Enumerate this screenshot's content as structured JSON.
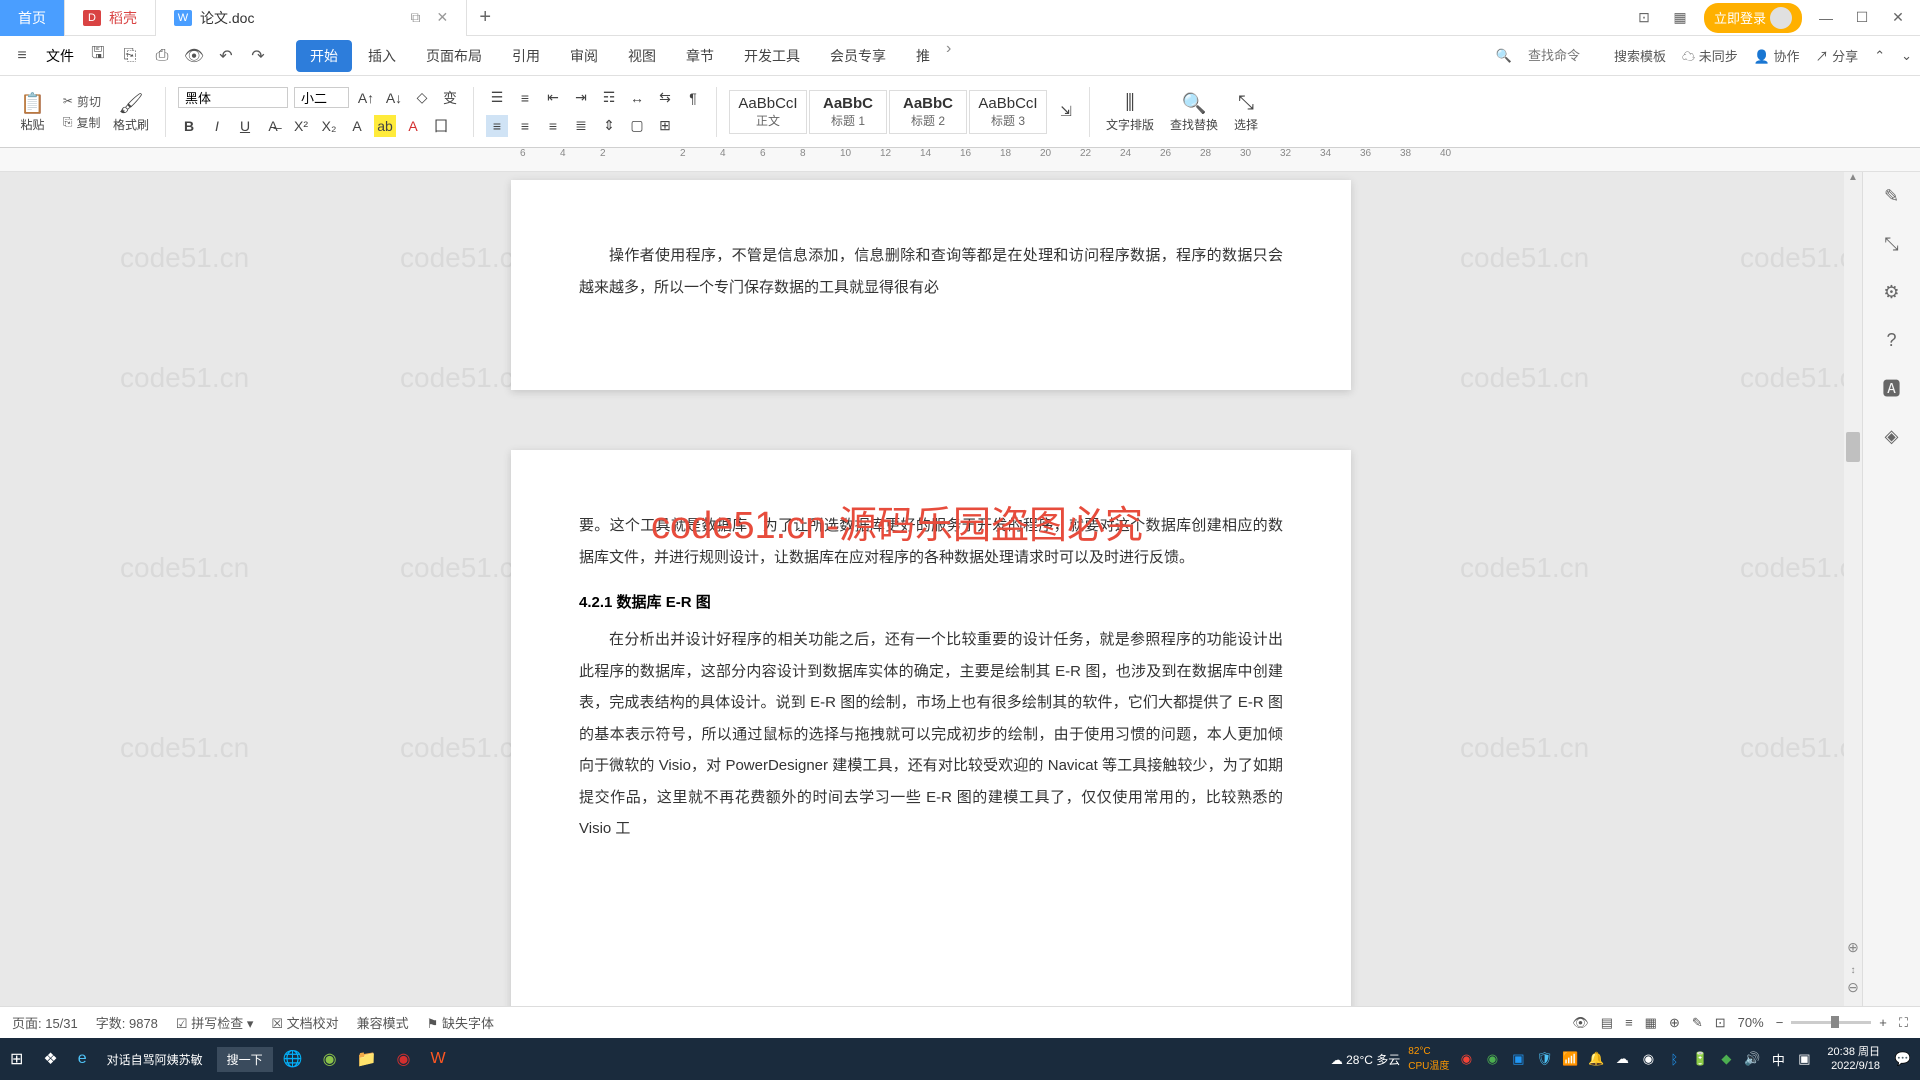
{
  "tabs": {
    "home": "首页",
    "daoke": "稻壳",
    "doc": "论文.doc"
  },
  "title_right": {
    "login": "立即登录"
  },
  "file_menu": "文件",
  "menu_tabs": [
    "开始",
    "插入",
    "页面布局",
    "引用",
    "审阅",
    "视图",
    "章节",
    "开发工具",
    "会员专享",
    "推"
  ],
  "menu_right": {
    "search_cmd": "查找命令",
    "search_tpl": "搜索模板",
    "unsync": "未同步",
    "coop": "协作",
    "share": "分享"
  },
  "clipboard": {
    "paste": "粘贴",
    "cut": "剪切",
    "copy": "复制",
    "fmt": "格式刷"
  },
  "font": {
    "name": "黑体",
    "size": "小二"
  },
  "styles": [
    {
      "prev": "AaBbCcI",
      "name": "正文"
    },
    {
      "prev": "AaBbC",
      "name": "标题 1"
    },
    {
      "prev": "AaBbC",
      "name": "标题 2"
    },
    {
      "prev": "AaBbCcI",
      "name": "标题 3"
    }
  ],
  "ribbon_right": {
    "layout": "文字排版",
    "find": "查找替换",
    "select": "选择"
  },
  "ruler_marks": [
    "6",
    "4",
    "2",
    "",
    "2",
    "4",
    "6",
    "8",
    "10",
    "12",
    "14",
    "16",
    "18",
    "20",
    "22",
    "24",
    "26",
    "28",
    "30",
    "32",
    "34",
    "36",
    "38",
    "40"
  ],
  "doc": {
    "p1": "操作者使用程序，不管是信息添加，信息删除和查询等都是在处理和访问程序数据，程序的数据只会越来越多，所以一个专门保存数据的工具就显得很有必",
    "p2": "要。这个工具就是数据库，为了让所选数据库更好的服务于开发的程序，就要对这个数据库创建相应的数据库文件，并进行规则设计，让数据库在应对程序的各种数据处理请求时可以及时进行反馈。",
    "h1": "4.2.1 数据库 E-R 图",
    "p3": "在分析出并设计好程序的相关功能之后，还有一个比较重要的设计任务，就是参照程序的功能设计出此程序的数据库，这部分内容设计到数据库实体的确定，主要是绘制其 E-R 图，也涉及到在数据库中创建表，完成表结构的具体设计。说到 E-R 图的绘制，市场上也有很多绘制其的软件，它们大都提供了 E-R 图的基本表示符号，所以通过鼠标的选择与拖拽就可以完成初步的绘制，由于使用习惯的问题，本人更加倾向于微软的 Visio，对 PowerDesigner 建模工具，还有对比较受欢迎的 Navicat 等工具接触较少，为了如期提交作品，这里就不再花费额外的时间去学习一些 E-R 图的建模工具了，仅仅使用常用的，比较熟悉的 Visio 工"
  },
  "red_text": "code51.cn-源码乐园盗图必究",
  "watermark": "code51.cn",
  "status": {
    "page": "页面: 15/31",
    "words": "字数: 9878",
    "spell": "拼写检查",
    "proof": "文档校对",
    "compat": "兼容模式",
    "missing": "缺失字体",
    "zoom": "70%"
  },
  "taskbar": {
    "search": "搜一下",
    "chat": "对话自骂阿姨苏敏",
    "weather": "28°C 多云",
    "temp": "82°C",
    "cpu": "CPU温度",
    "time": "20:38 周日",
    "date": "2022/9/18"
  }
}
